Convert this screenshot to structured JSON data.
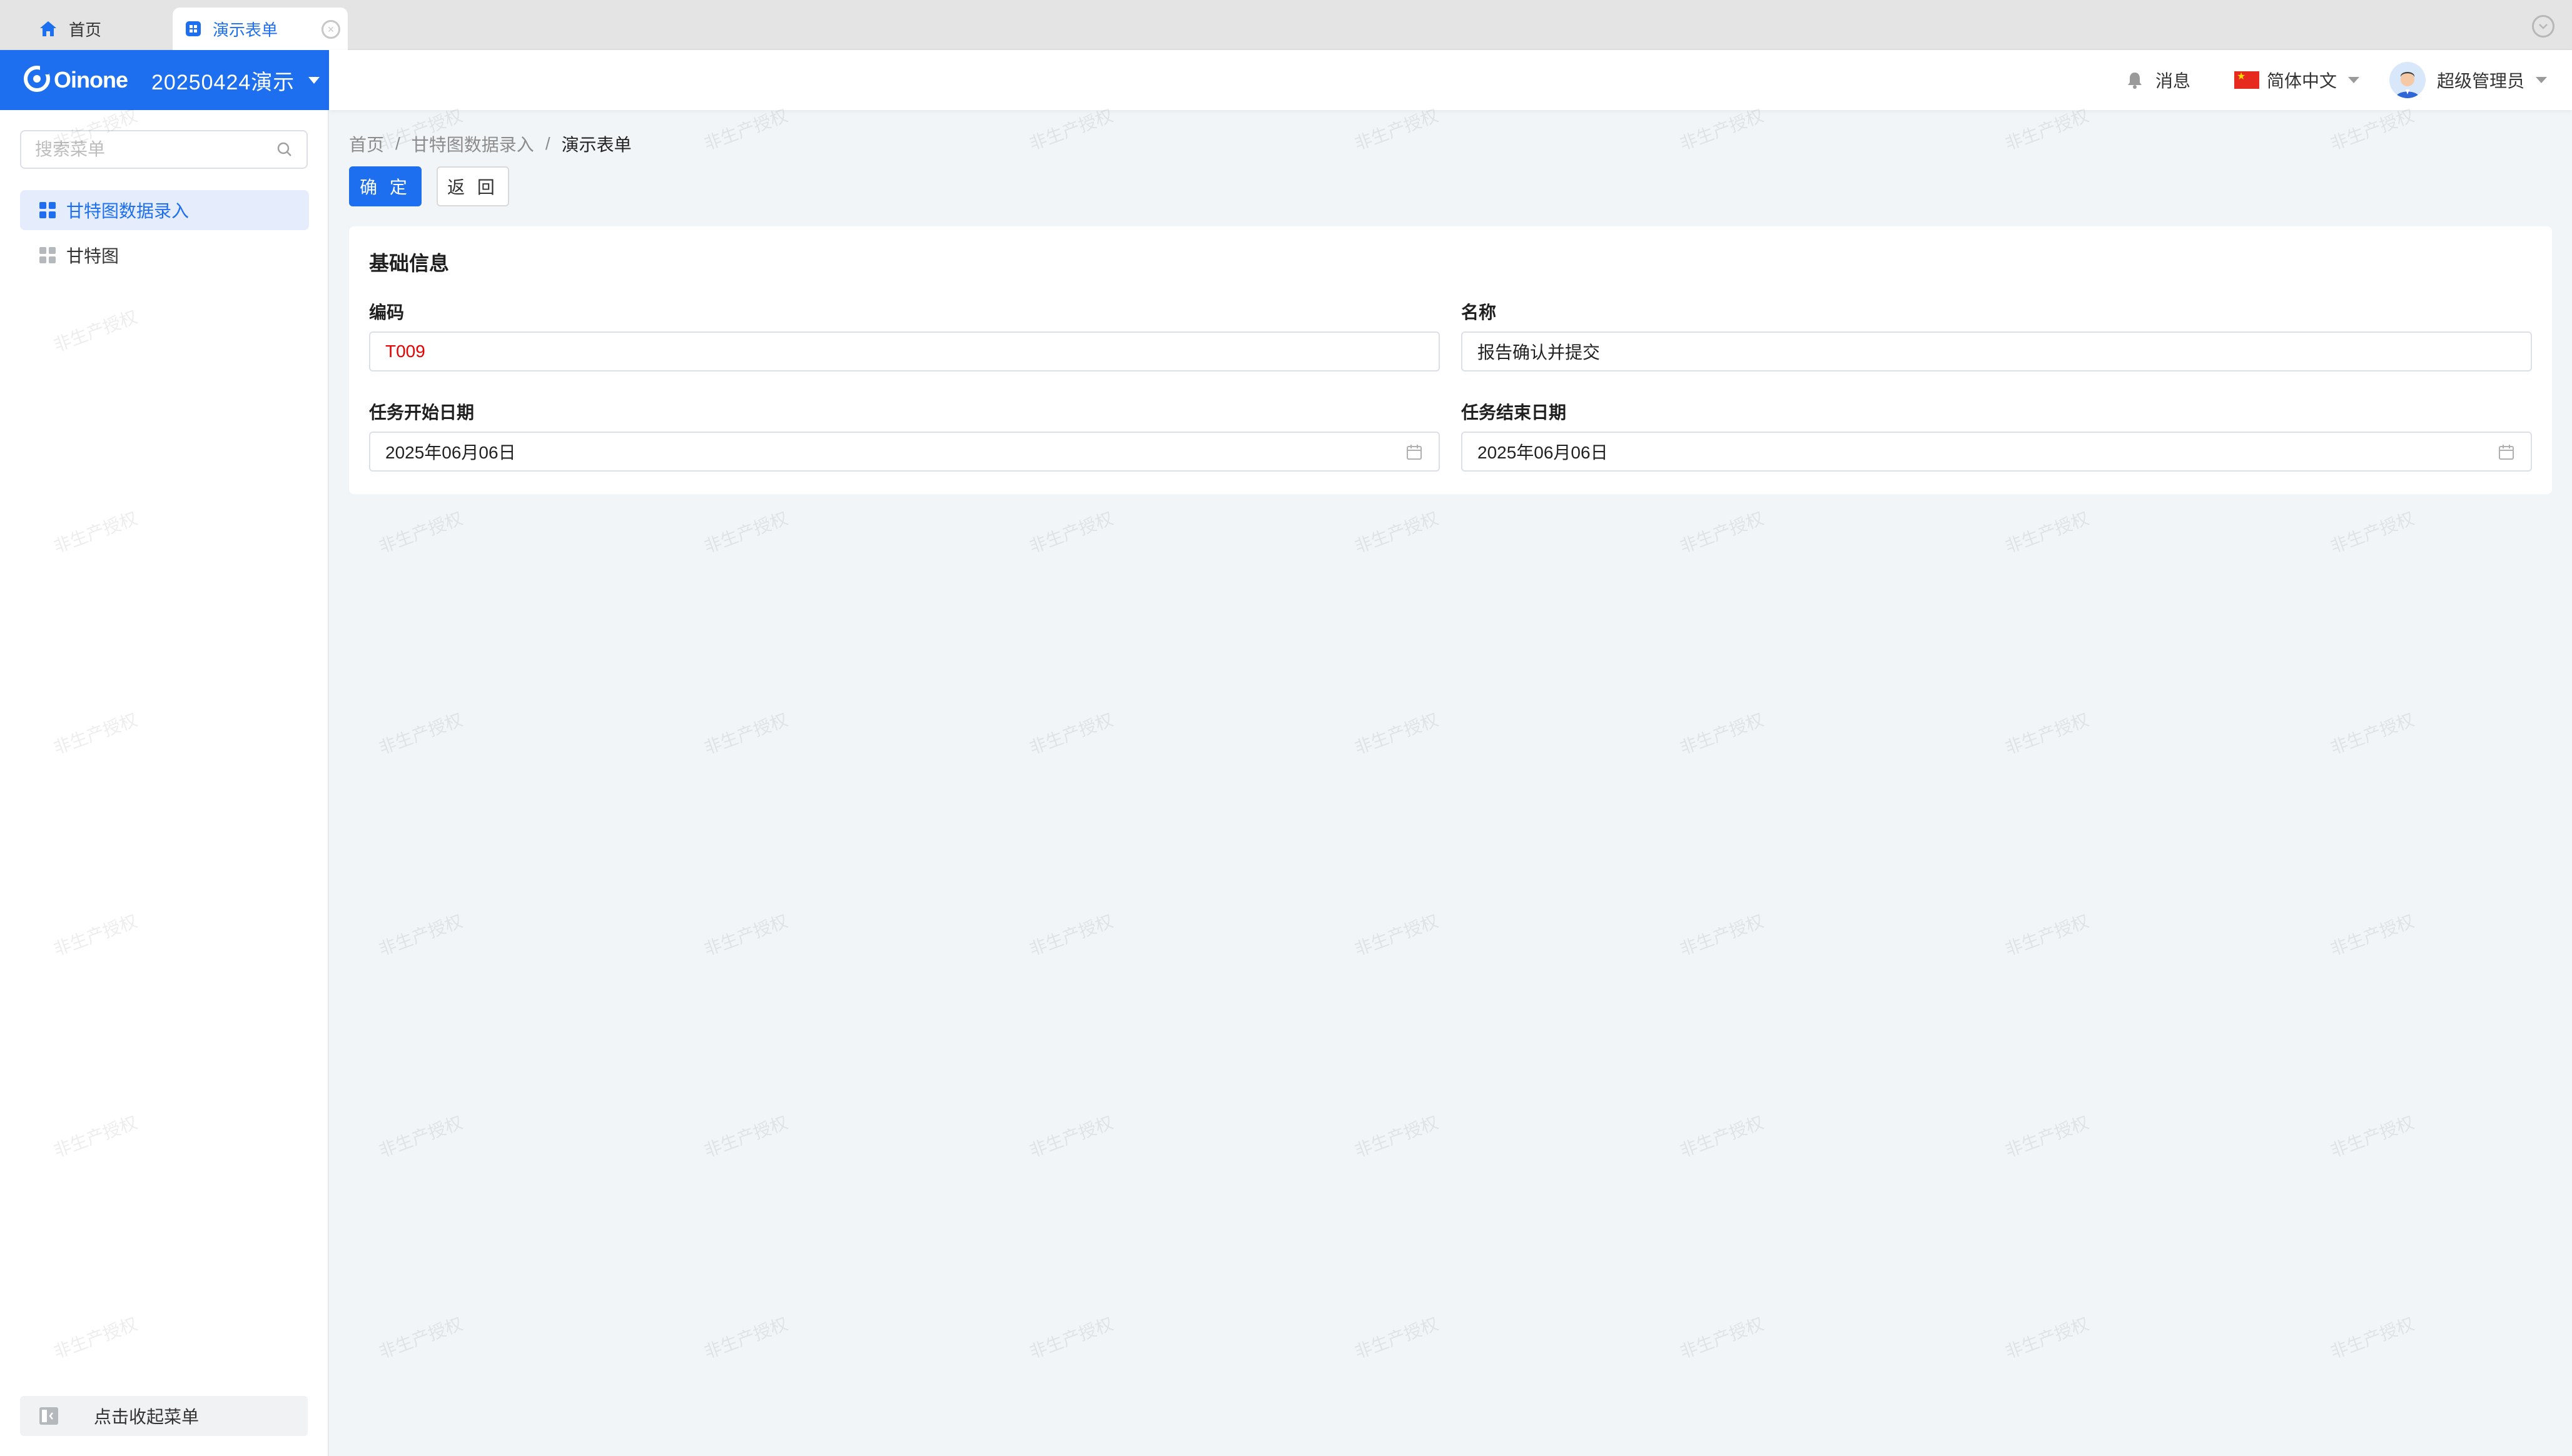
{
  "tabs": [
    {
      "label": "首页",
      "icon": "home-icon"
    },
    {
      "label": "演示表单",
      "icon": "form-icon"
    }
  ],
  "brand": {
    "logo_text": "Oinone",
    "app_name": "20250424演示"
  },
  "header": {
    "messages_label": "消息",
    "language_label": "简体中文",
    "user_name": "超级管理员"
  },
  "sidebar": {
    "search_placeholder": "搜索菜单",
    "items": [
      {
        "label": "甘特图数据录入",
        "active": true
      },
      {
        "label": "甘特图",
        "active": false
      }
    ],
    "collapse_label": "点击收起菜单"
  },
  "breadcrumb": [
    "首页",
    "甘特图数据录入",
    "演示表单"
  ],
  "actions": {
    "confirm_label": "确 定",
    "back_label": "返 回"
  },
  "form": {
    "section_title": "基础信息",
    "code_label": "编码",
    "code_value": "T009",
    "name_label": "名称",
    "name_value": "报告确认并提交",
    "start_label": "任务开始日期",
    "start_value": "2025年06月06日",
    "end_label": "任务结束日期",
    "end_value": "2025年06月06日"
  },
  "watermark": {
    "text": "非生产授权"
  },
  "colors": {
    "primary": "#1d6ff0",
    "code_value": "#e60000",
    "background": "#f2f5f8"
  }
}
